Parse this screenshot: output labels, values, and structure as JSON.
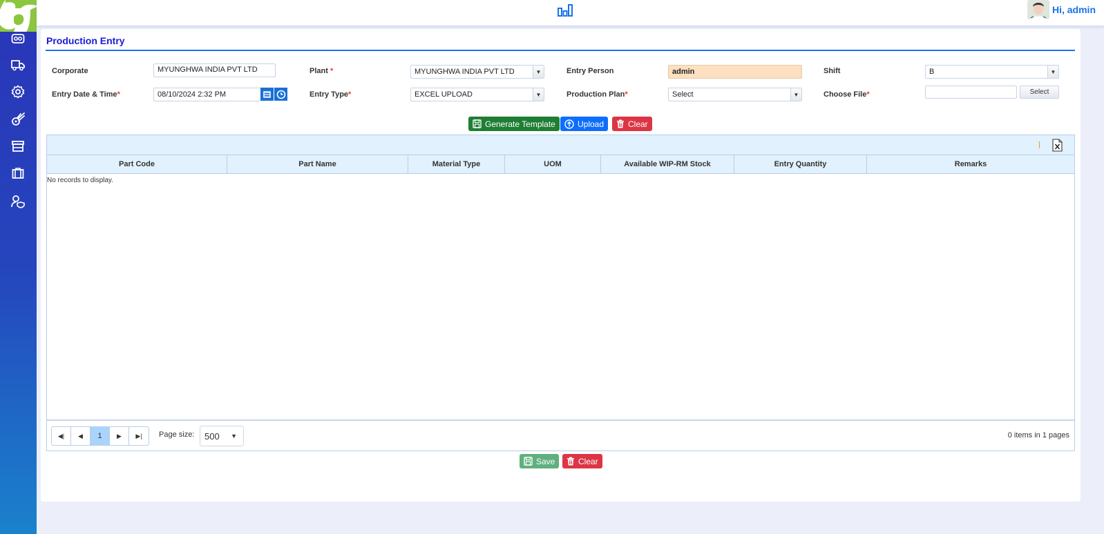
{
  "header": {
    "user_greeting": "Hi, admin"
  },
  "sidebar": {
    "items": [
      {
        "icon": "vr-headset-icon"
      },
      {
        "icon": "truck-icon"
      },
      {
        "icon": "gear-icon"
      },
      {
        "icon": "comet-icon"
      },
      {
        "icon": "archive-icon"
      },
      {
        "icon": "briefcase-icon"
      },
      {
        "icon": "user-shield-icon"
      }
    ]
  },
  "page": {
    "title": "Production Entry"
  },
  "form": {
    "corporate": {
      "label": "Corporate",
      "value": "MYUNGHWA INDIA PVT LTD"
    },
    "plant": {
      "label": "Plant ",
      "required": "*",
      "value": "MYUNGHWA INDIA PVT LTD"
    },
    "entry_person": {
      "label": "Entry Person",
      "value": "admin"
    },
    "shift": {
      "label": "Shift",
      "value": "B"
    },
    "entry_datetime": {
      "label": "Entry Date & Time",
      "required": "*",
      "value": "08/10/2024 2:32 PM"
    },
    "entry_type": {
      "label": "Entry Type",
      "required": "*",
      "value": "EXCEL UPLOAD"
    },
    "production_plan": {
      "label": "Production Plan",
      "required": "*",
      "value": "Select"
    },
    "choose_file": {
      "label": "Choose File",
      "required": "*",
      "value": "",
      "button": "Select"
    }
  },
  "actions": {
    "generate_template": "Generate Template",
    "upload": "Upload",
    "clear": "Clear"
  },
  "grid": {
    "columns": [
      "Part Code",
      "Part Name",
      "Material Type",
      "UOM",
      "Available WIP-RM Stock",
      "Entry Quantity",
      "Remarks"
    ],
    "empty_message": "No records to display.",
    "pager": {
      "current_page": "1",
      "page_size_label": "Page size:",
      "page_size": "500",
      "info": "0 items in 1 pages"
    }
  },
  "footer_actions": {
    "save": "Save",
    "clear": "Clear"
  }
}
